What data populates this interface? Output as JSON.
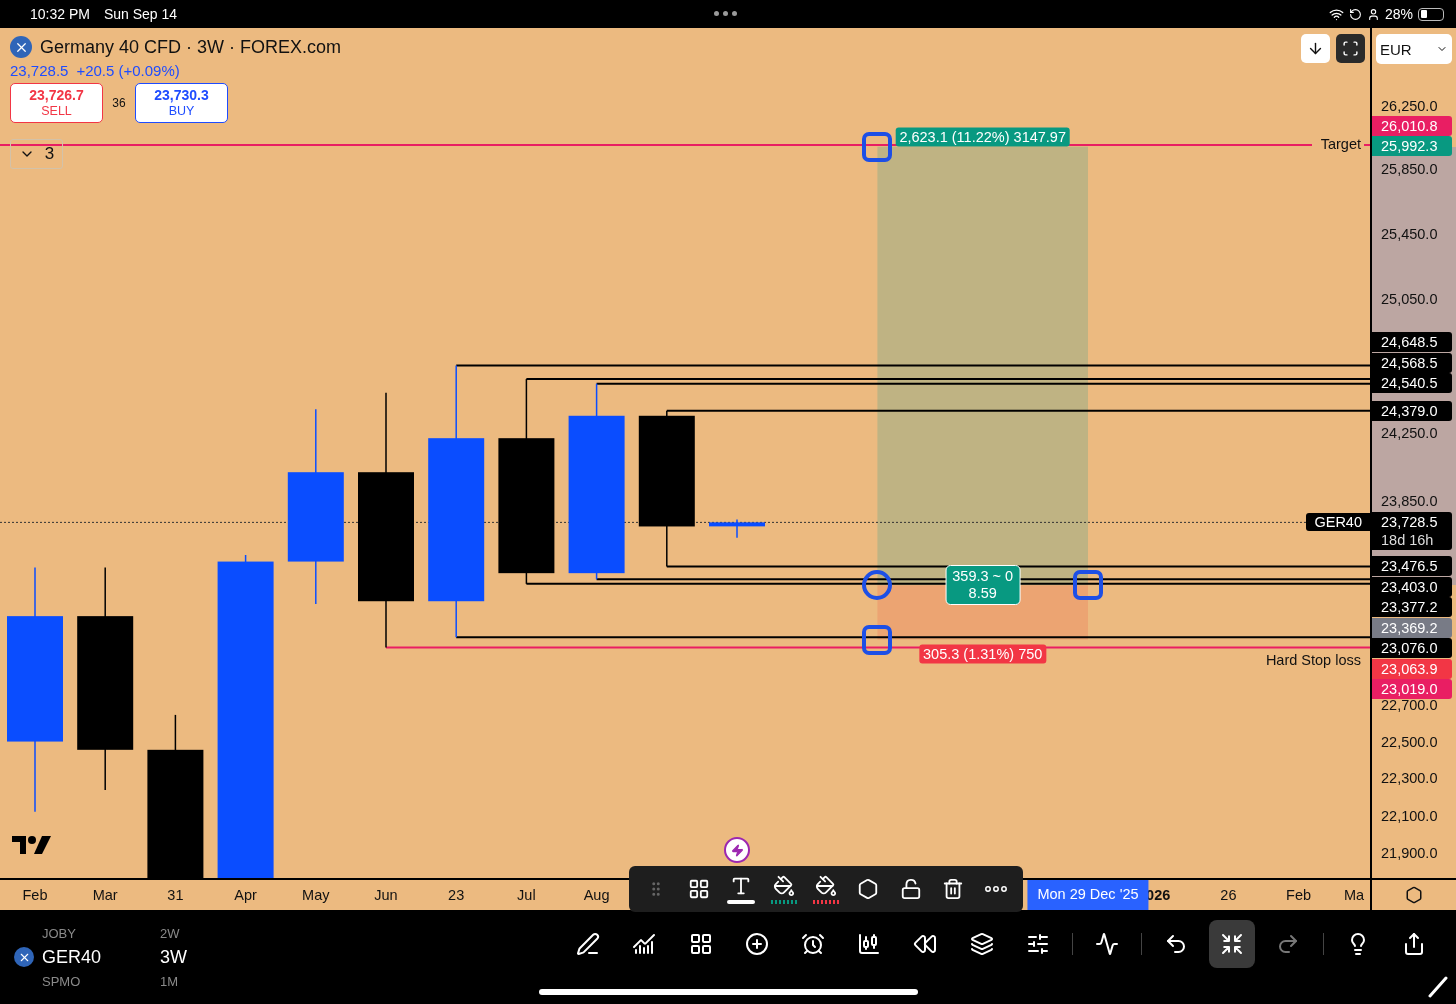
{
  "status_bar": {
    "time": "10:32 PM",
    "date": "Sun Sep 14",
    "battery": "28%"
  },
  "legend": {
    "title": "Germany 40 CFD · 3W · FOREX.com",
    "price": "23,728.5",
    "change": "+20.5 (+0.09%)",
    "sell": {
      "price": "23,726.7",
      "label": "SELL"
    },
    "spread": "36",
    "buy": {
      "price": "23,730.3",
      "label": "BUY"
    },
    "indicators_count": "3",
    "indicators_expanded": false
  },
  "chart_buttons": [
    {
      "kind": "scroll-down",
      "selected": false
    },
    {
      "kind": "fit",
      "selected": true
    }
  ],
  "currency": "EUR",
  "chart": {
    "levels": [
      {
        "kind": "target",
        "label": "Target"
      },
      {
        "kind": "stop",
        "label": "Hard Stop loss"
      }
    ],
    "symbol_tag": "GER40",
    "position": {
      "target_label": "2,623.1 (11.22%) 3147.97",
      "center_label": [
        "359.3 ~ 0",
        "8.59"
      ],
      "stop_label": "305.3 (1.31%) 750"
    }
  },
  "price_axis": {
    "ticks": [
      "26,250.0",
      "25,850.0",
      "25,450.0",
      "25,050.0",
      "24,250.0",
      "23,850.0",
      "22,700.0",
      "22,500.0",
      "22,300.0",
      "22,100.0",
      "21,900.0"
    ],
    "tags": [
      {
        "text": "26,010.8",
        "color": "#e91e63"
      },
      {
        "text": "25,992.3",
        "color": "#089981"
      },
      {
        "text": "24,648.5",
        "color": "#000000"
      },
      {
        "text": "24,568.5",
        "color": "#000000"
      },
      {
        "text": "24,540.5",
        "color": "#000000"
      },
      {
        "text": "24,379.0",
        "color": "#000000"
      },
      {
        "text": "23,728.5",
        "sub": "18d 16h",
        "color": "#000000"
      },
      {
        "text": "23,476.5",
        "color": "#000000"
      },
      {
        "text": "23,403.0",
        "color": "#000000"
      },
      {
        "text": "23,377.2",
        "color": "#000000"
      },
      {
        "text": "23,369.2",
        "color": "#787b86"
      },
      {
        "text": "23,076.0",
        "color": "#000000"
      },
      {
        "text": "23,063.9",
        "color": "#f23645"
      },
      {
        "text": "23,019.0",
        "color": "#e91e63"
      }
    ]
  },
  "time_axis": {
    "labels": [
      {
        "text": "Feb",
        "bold": false
      },
      {
        "text": "Mar",
        "bold": false
      },
      {
        "text": "31",
        "bold": false
      },
      {
        "text": "Apr",
        "bold": false
      },
      {
        "text": "May",
        "bold": false
      },
      {
        "text": "Jun",
        "bold": false
      },
      {
        "text": "23",
        "bold": false
      },
      {
        "text": "Jul",
        "bold": false
      },
      {
        "text": "Aug",
        "bold": false
      },
      {
        "text": "026",
        "bold": true
      },
      {
        "text": "26",
        "bold": false
      },
      {
        "text": "Feb",
        "bold": false
      },
      {
        "text": "Ma",
        "bold": false
      }
    ],
    "cursor": {
      "text": "Mon 29 Dec '25"
    }
  },
  "drawing_toolbar": [
    {
      "kind": "grip",
      "selected": false
    },
    {
      "kind": "add",
      "selected": false
    },
    {
      "kind": "text",
      "selected": true
    },
    {
      "kind": "fill",
      "color": "#089981",
      "selected": false
    },
    {
      "kind": "fill",
      "color": "#f23645",
      "selected": false
    },
    {
      "kind": "settings",
      "selected": false
    },
    {
      "kind": "lock",
      "selected": false
    },
    {
      "kind": "delete",
      "selected": false
    },
    {
      "kind": "more",
      "selected": false
    }
  ],
  "bottom_bar": {
    "symbols": [
      {
        "symbol": "JOBY",
        "interval": "2W",
        "selected": false
      },
      {
        "symbol": "GER40",
        "interval": "3W",
        "selected": true
      },
      {
        "symbol": "SPMO",
        "interval": "1M",
        "selected": false
      }
    ],
    "tools": [
      {
        "kind": "draw",
        "selected": false
      },
      {
        "kind": "indicators",
        "selected": false
      },
      {
        "kind": "layouts",
        "selected": false
      },
      {
        "kind": "add",
        "selected": false
      },
      {
        "kind": "alert",
        "selected": false
      },
      {
        "kind": "candles",
        "selected": false
      },
      {
        "kind": "replay",
        "selected": false
      },
      {
        "kind": "layers",
        "selected": false
      },
      {
        "kind": "settings",
        "selected": false
      },
      {
        "kind": "separator"
      },
      {
        "kind": "compare",
        "selected": false
      },
      {
        "kind": "separator"
      },
      {
        "kind": "undo",
        "selected": false
      },
      {
        "kind": "collapse",
        "selected": true
      },
      {
        "kind": "redo",
        "selected": false
      },
      {
        "kind": "separator"
      },
      {
        "kind": "ideas",
        "selected": false
      },
      {
        "kind": "share",
        "selected": false
      }
    ]
  }
}
